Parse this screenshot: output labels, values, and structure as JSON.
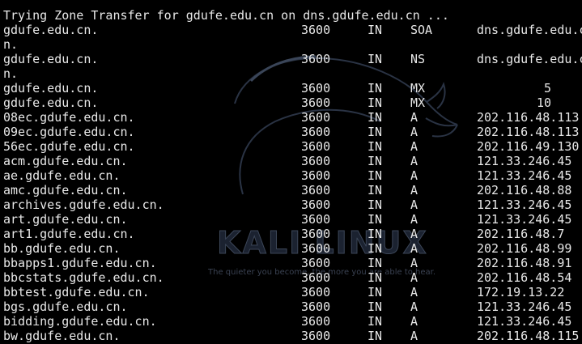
{
  "terminal": {
    "header": "Trying Zone Transfer for gdufe.edu.cn on dns.gdufe.edu.cn ...",
    "soa": {
      "name": "gdufe.edu.cn.",
      "ttl": "3600",
      "class": "IN",
      "type": "SOA",
      "data": "dns.gdufe.edu.c",
      "wrap": "n."
    },
    "ns": {
      "name": "gdufe.edu.cn.",
      "ttl": "3600",
      "class": "IN",
      "type": "NS",
      "data": "dns.gdufe.edu.c",
      "wrap": "n."
    },
    "mx": [
      {
        "name": "gdufe.edu.cn.",
        "ttl": "3600",
        "class": "IN",
        "type": "MX",
        "pref": "5"
      },
      {
        "name": "gdufe.edu.cn.",
        "ttl": "3600",
        "class": "IN",
        "type": "MX",
        "pref": "10"
      }
    ],
    "a_records": [
      {
        "name": "08ec.gdufe.edu.cn.",
        "ttl": "3600",
        "class": "IN",
        "type": "A",
        "data": "202.116.48.113"
      },
      {
        "name": "09ec.gdufe.edu.cn.",
        "ttl": "3600",
        "class": "IN",
        "type": "A",
        "data": "202.116.48.113"
      },
      {
        "name": "56ec.gdufe.edu.cn.",
        "ttl": "3600",
        "class": "IN",
        "type": "A",
        "data": "202.116.49.130"
      },
      {
        "name": "acm.gdufe.edu.cn.",
        "ttl": "3600",
        "class": "IN",
        "type": "A",
        "data": "121.33.246.45"
      },
      {
        "name": "ae.gdufe.edu.cn.",
        "ttl": "3600",
        "class": "IN",
        "type": "A",
        "data": "121.33.246.45"
      },
      {
        "name": "amc.gdufe.edu.cn.",
        "ttl": "3600",
        "class": "IN",
        "type": "A",
        "data": "202.116.48.88"
      },
      {
        "name": "archives.gdufe.edu.cn.",
        "ttl": "3600",
        "class": "IN",
        "type": "A",
        "data": "121.33.246.45"
      },
      {
        "name": "art.gdufe.edu.cn.",
        "ttl": "3600",
        "class": "IN",
        "type": "A",
        "data": "121.33.246.45"
      },
      {
        "name": "art1.gdufe.edu.cn.",
        "ttl": "3600",
        "class": "IN",
        "type": "A",
        "data": "202.116.48.7"
      },
      {
        "name": "bb.gdufe.edu.cn.",
        "ttl": "3600",
        "class": "IN",
        "type": "A",
        "data": "202.116.48.99"
      },
      {
        "name": "bbapps1.gdufe.edu.cn.",
        "ttl": "3600",
        "class": "IN",
        "type": "A",
        "data": "202.116.48.91"
      },
      {
        "name": "bbcstats.gdufe.edu.cn.",
        "ttl": "3600",
        "class": "IN",
        "type": "A",
        "data": "202.116.48.54"
      },
      {
        "name": "bbtest.gdufe.edu.cn.",
        "ttl": "3600",
        "class": "IN",
        "type": "A",
        "data": "172.19.13.22"
      },
      {
        "name": "bgs.gdufe.edu.cn.",
        "ttl": "3600",
        "class": "IN",
        "type": "A",
        "data": "121.33.246.45"
      },
      {
        "name": "bidding.gdufe.edu.cn.",
        "ttl": "3600",
        "class": "IN",
        "type": "A",
        "data": "121.33.246.45"
      },
      {
        "name": "bw.gdufe.edu.cn.",
        "ttl": "3600",
        "class": "IN",
        "type": "A",
        "data": "202.116.48.115"
      }
    ]
  },
  "wallpaper": {
    "logo_text": "KALI LINUX",
    "slogan": "The quieter you become, the more you are able to hear.",
    "icon": "kali-dragon-icon"
  },
  "colors": {
    "background": "#000000",
    "text": "#e8e8e8",
    "wallpaper_accent": "#3c4658"
  }
}
